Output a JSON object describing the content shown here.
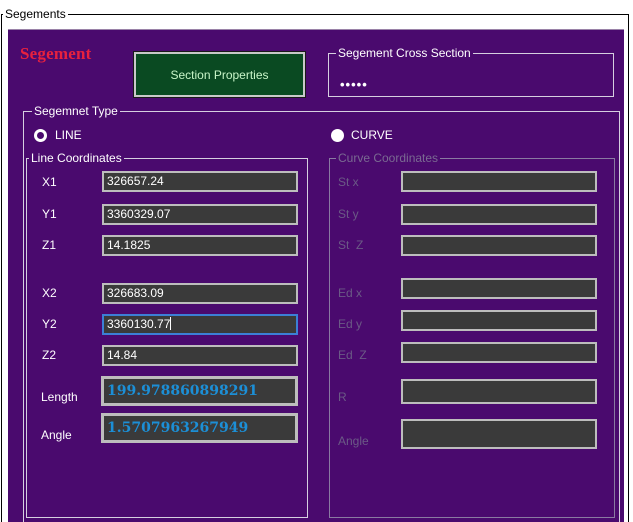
{
  "outer_group": {
    "legend": "Segements"
  },
  "header": {
    "title": "Segement",
    "section_button": "Section Properties",
    "cross_section": {
      "legend": "Segement Cross Section",
      "value": "•••••"
    }
  },
  "segment_type": {
    "legend": "Segemnet Type",
    "line_radio": {
      "label": "LINE",
      "checked": false
    },
    "curve_radio": {
      "label": "CURVE",
      "checked": true
    }
  },
  "line_coordinates": {
    "legend": "Line Coordinates",
    "x1": {
      "label": "X1",
      "value": "326657.24"
    },
    "y1": {
      "label": "Y1",
      "value": "3360329.07"
    },
    "z1": {
      "label": "Z1",
      "value": "14.1825"
    },
    "x2": {
      "label": "X2",
      "value": "326683.09"
    },
    "y2": {
      "label": "Y2",
      "value": "3360130.77"
    },
    "z2": {
      "label": "Z2",
      "value": "14.84"
    },
    "length": {
      "label": "Length",
      "value": "199.978860898291"
    },
    "angle": {
      "label": "Angle",
      "value": "1.5707963267949"
    }
  },
  "curve_coordinates": {
    "legend": "Curve Coordinates",
    "st_x": {
      "label": "St x",
      "value": ""
    },
    "st_y": {
      "label": "St y",
      "value": ""
    },
    "st_z": {
      "label": "St  Z",
      "value": ""
    },
    "ed_x": {
      "label": "Ed x",
      "value": ""
    },
    "ed_y": {
      "label": "Ed y",
      "value": ""
    },
    "ed_z": {
      "label": "Ed  Z",
      "value": ""
    },
    "r": {
      "label": "R",
      "value": ""
    },
    "angle": {
      "label": "Angle",
      "value": ""
    }
  },
  "colors": {
    "panel_bg": "#4a0a6e",
    "title_red": "#e8213e",
    "computed_value_blue": "#1c8fd6",
    "button_bg": "#0a4a22",
    "focus_border": "#3c7fd6"
  }
}
